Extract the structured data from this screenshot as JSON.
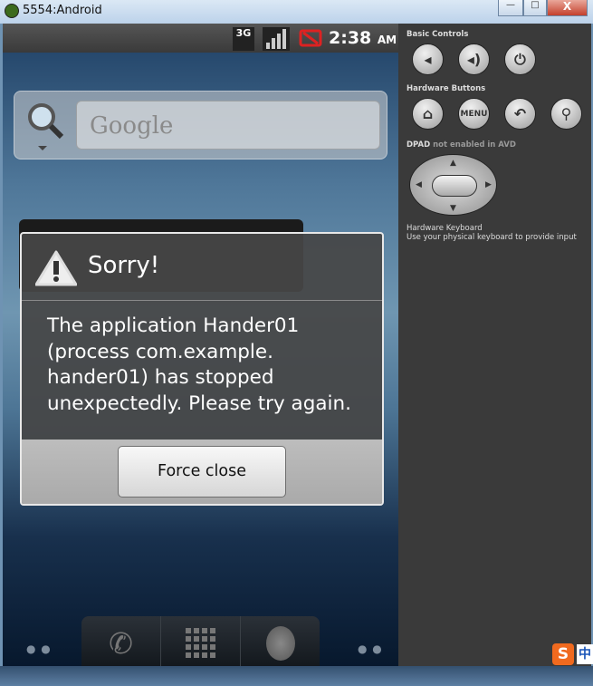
{
  "window": {
    "title": "5554:Android",
    "minimize": "—",
    "maximize": "□",
    "close": "X"
  },
  "statusbar": {
    "network": "3G",
    "time": "2:38",
    "ampm": "AM"
  },
  "search_widget": {
    "placeholder": "Google"
  },
  "dialog": {
    "title": "Sorry!",
    "message": "The application Hander01 (process com.example. hander01) has stopped unexpectedly. Please try again.",
    "button": "Force close"
  },
  "panel": {
    "basic_controls": "Basic Controls",
    "hardware_buttons": "Hardware Buttons",
    "dpad_label": "DPAD",
    "dpad_note": "not enabled in AVD",
    "keyboard_title": "Hardware Keyboard",
    "keyboard_note": "Use your physical keyboard to provide input",
    "menu_label": "MENU"
  },
  "ime": {
    "logo": "S",
    "mode": "中"
  }
}
